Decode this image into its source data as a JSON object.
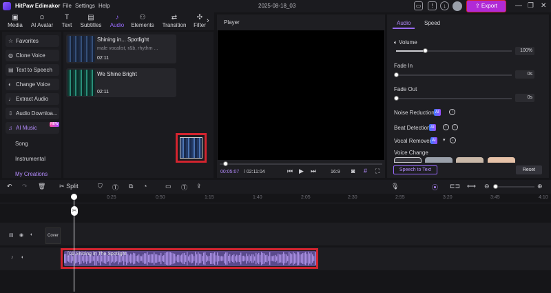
{
  "titlebar": {
    "app": "HitPaw Edimakor",
    "menus": [
      "File",
      "Settings",
      "Help"
    ],
    "project": "2025-08-18_03",
    "export": "Export"
  },
  "toolbar": {
    "tabs": [
      "Media",
      "AI Avatar",
      "Text",
      "Subtitles",
      "Audio",
      "Elements",
      "Transition",
      "Filter"
    ],
    "active": "Audio"
  },
  "sidebar": {
    "items": [
      "Favorites",
      "Clone Voice",
      "Text to Speech",
      "Change Voice",
      "Extract Audio",
      "Audio Downloa...",
      "AI Music"
    ],
    "new_badge": "NEW",
    "sub": [
      "Song",
      "Instrumental",
      "My Creations"
    ]
  },
  "media": {
    "cards": [
      {
        "title": "Shining in... Spotlight",
        "sub": "male vocalist, r&b, rhythm ...",
        "dur": "02:11"
      },
      {
        "title": "We Shine Bright",
        "sub": "",
        "dur": "02:11"
      }
    ]
  },
  "player": {
    "title": "Player",
    "current": "00:05:07",
    "total": "/ 02:11:04",
    "ratio": "16:9"
  },
  "right": {
    "tabs": [
      "Audio",
      "Speed"
    ],
    "volume_label": "Volume",
    "volume_value": "100%",
    "volume_level": 0.25,
    "fadein_label": "Fade In",
    "fadein_value": "0s",
    "fadeout_label": "Fade Out",
    "fadeout_value": "0s",
    "noise": "Noise Reduction",
    "beat": "Beat Detection",
    "vocal": "Vocal Remover",
    "ai_tag": "AI",
    "voice_change": "Voice Change",
    "speech_to_text": "Speech to Text",
    "reset": "Reset"
  },
  "edit": {
    "split": "Split"
  },
  "ruler": {
    "ticks": [
      "0:25",
      "0:50",
      "1:15",
      "1:40",
      "2:05",
      "2:30",
      "2:55",
      "3:20",
      "3:45",
      "4:10"
    ]
  },
  "timeline": {
    "cover": "Cover",
    "clip_label": "[01 Shining in The Spotlight"
  },
  "colors": {
    "accent": "#9a6bff",
    "export": "#b12ad6",
    "highlight": "#d3242f"
  }
}
